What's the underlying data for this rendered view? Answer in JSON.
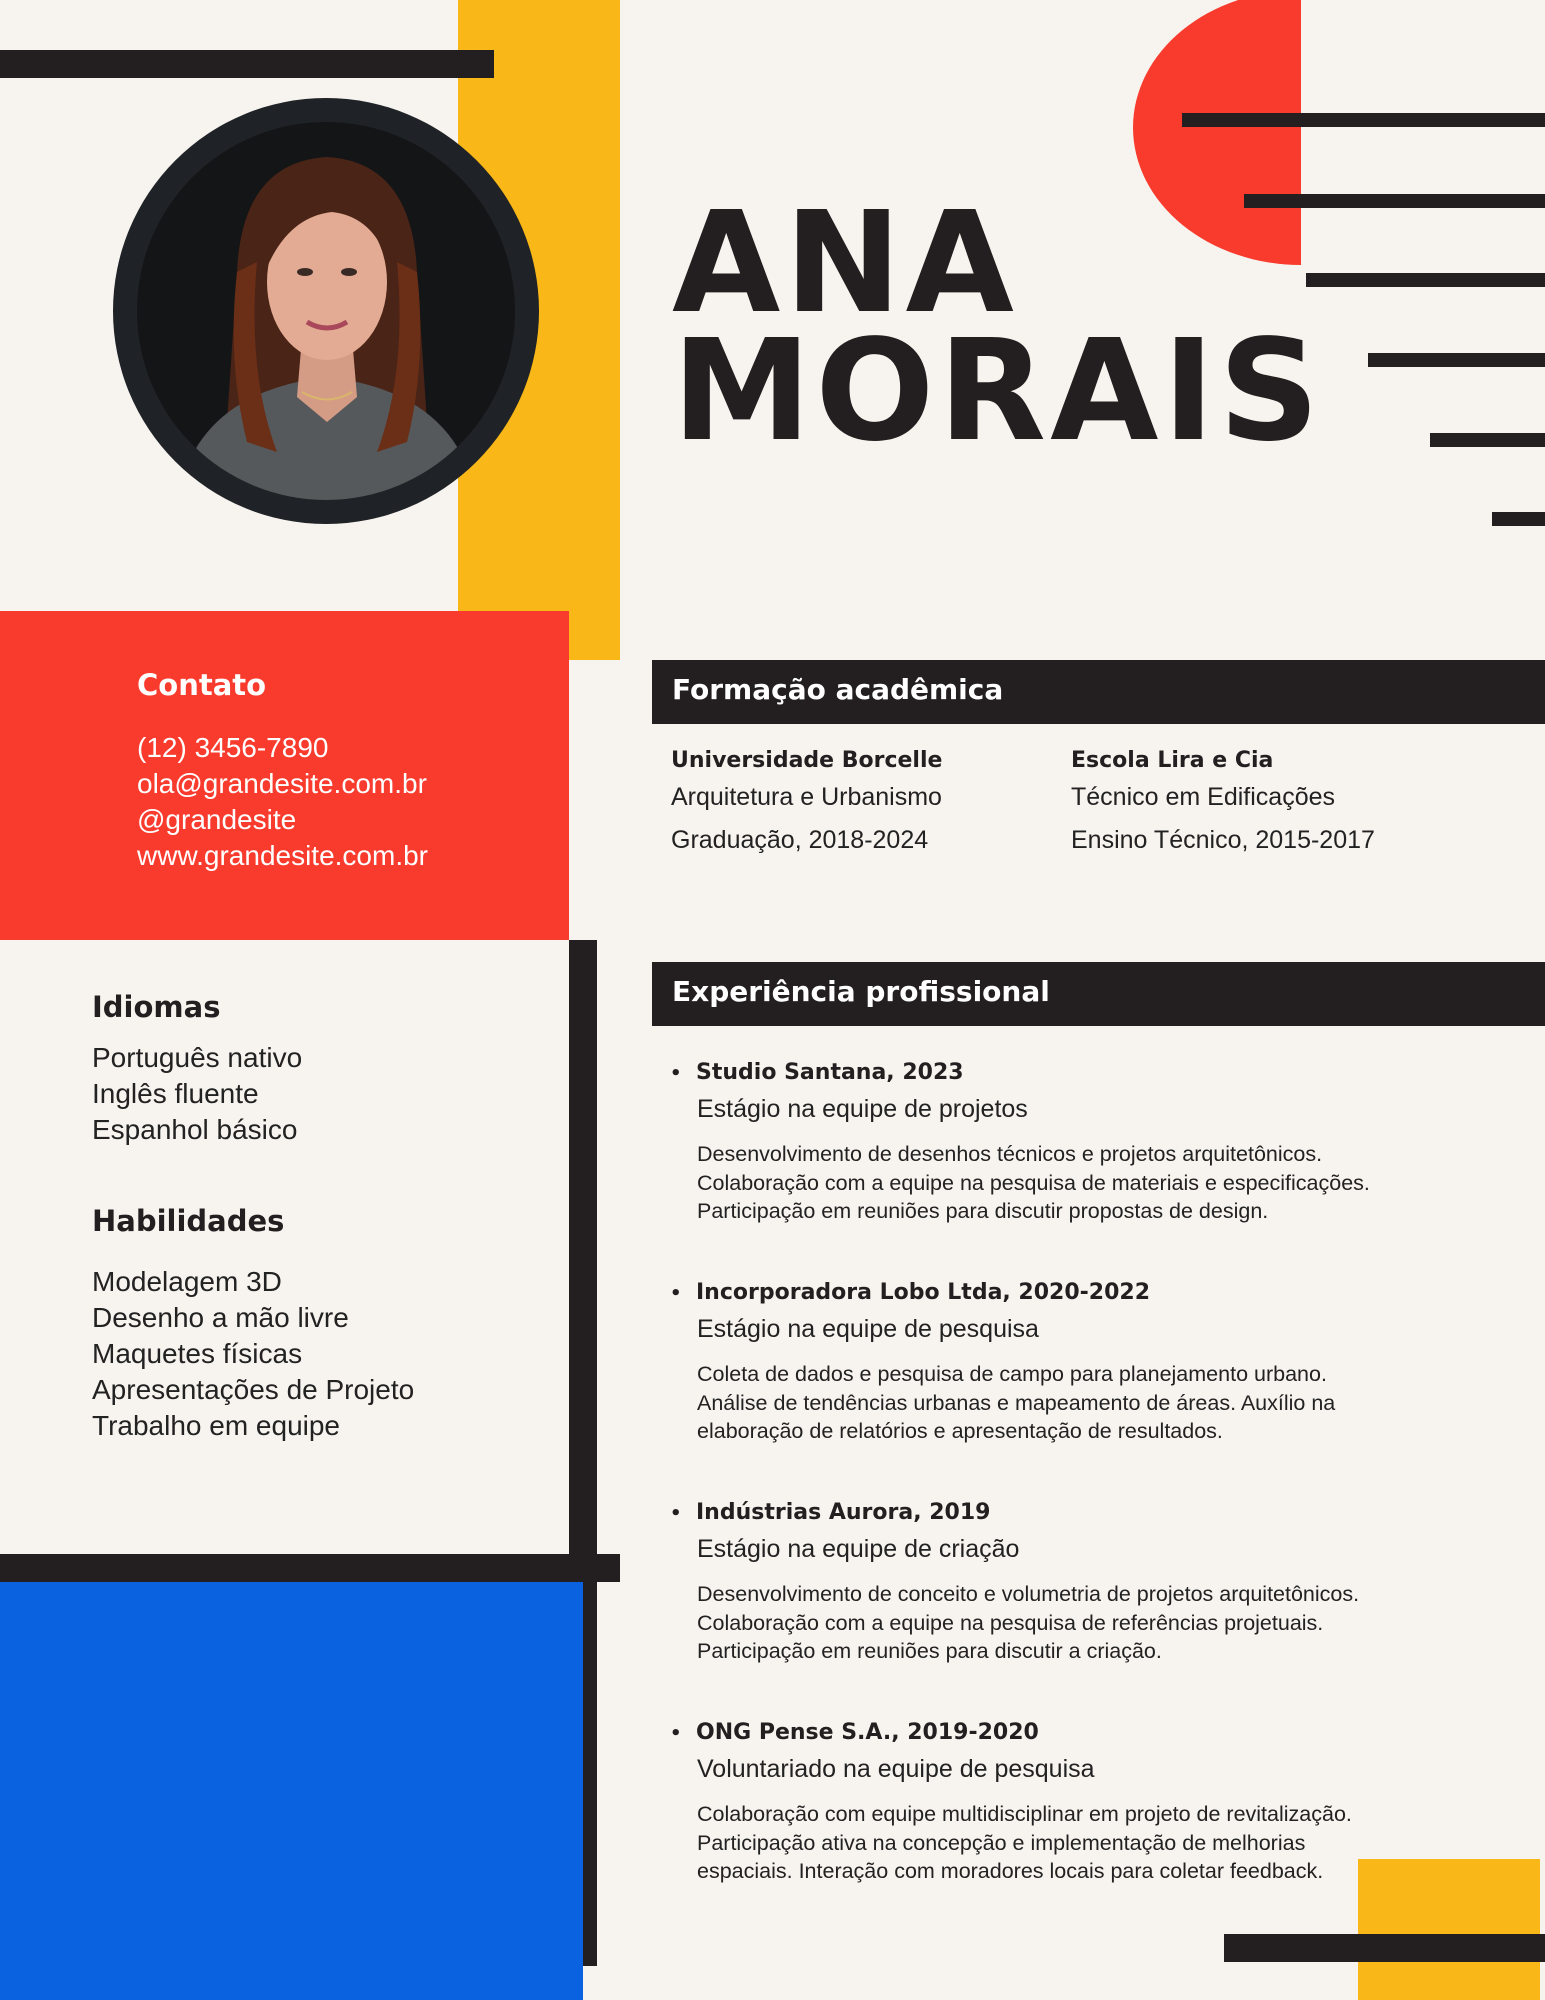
{
  "name": {
    "first": "ANA",
    "last": "MORAIS"
  },
  "photo": {
    "icon": "portrait-photo"
  },
  "contact": {
    "title": "Contato",
    "phone": "(12) 3456-7890",
    "email": "ola@grandesite.com.br",
    "social": "@grandesite",
    "website": "www.grandesite.com.br"
  },
  "languages": {
    "title": "Idiomas",
    "items": [
      "Português nativo",
      "Inglês fluente",
      "Espanhol básico"
    ]
  },
  "skills": {
    "title": "Habilidades",
    "items": [
      "Modelagem 3D",
      "Desenho a mão livre",
      "Maquetes físicas",
      "Apresentações de Projeto",
      "Trabalho em equipe"
    ]
  },
  "education": {
    "title": "Formação acadêmica",
    "items": [
      {
        "school": "Universidade Borcelle",
        "course": "Arquitetura e Urbanismo",
        "period": "Graduação, 2018-2024"
      },
      {
        "school": "Escola Lira e Cia",
        "course": "Técnico em Edificações",
        "period": "Ensino Técnico, 2015-2017"
      }
    ]
  },
  "experience": {
    "title": "Experiência profissional",
    "bullet": "•",
    "items": [
      {
        "company": "Studio Santana, 2023",
        "role": "Estágio na equipe de projetos",
        "description": [
          "Desenvolvimento de desenhos técnicos e projetos arquitetônicos.",
          "Colaboração com a equipe na pesquisa de materiais e especificações.",
          "Participação em reuniões para discutir propostas de design."
        ]
      },
      {
        "company": "Incorporadora Lobo Ltda, 2020-2022",
        "role": "Estágio na equipe de pesquisa",
        "description": [
          "Coleta de dados e pesquisa de campo para planejamento urbano.",
          "Análise de tendências urbanas e mapeamento de áreas. Auxílio na",
          "elaboração de relatórios e apresentação de resultados."
        ]
      },
      {
        "company": "Indústrias Aurora, 2019",
        "role": "Estágio na equipe de criação",
        "description": [
          "Desenvolvimento de conceito e volumetria de projetos arquitetônicos.",
          "Colaboração com a equipe na pesquisa de referências projetuais.",
          "Participação em reuniões para discutir a criação."
        ]
      },
      {
        "company": "ONG Pense S.A., 2019-2020",
        "role": "Voluntariado na equipe de pesquisa",
        "description": [
          "Colaboração com equipe multidisciplinar em projeto de revitalização.",
          "Participação ativa na concepção e implementação de melhorias",
          "espaciais. Interação com moradores locais para coletar feedback."
        ]
      }
    ]
  },
  "colors": {
    "background": "#f7f4ef",
    "dark": "#231f20",
    "red": "#f93b2e",
    "yellow": "#f9b818",
    "blue": "#0a62e1"
  }
}
